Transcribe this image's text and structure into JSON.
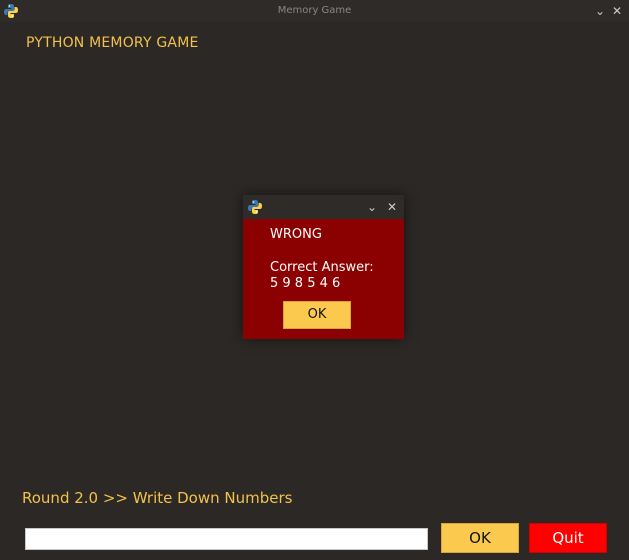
{
  "window": {
    "title": "Memory Game",
    "icon": "python-logo-icon",
    "minimize_glyph": "⌄",
    "close_glyph": "✕"
  },
  "app": {
    "heading": "PYTHON MEMORY GAME",
    "round_label": "Round 2.0 >> Write Down Numbers"
  },
  "input": {
    "value": ""
  },
  "buttons": {
    "ok_label": "OK",
    "quit_label": "Quit"
  },
  "dialog": {
    "icon": "python-logo-icon",
    "minimize_glyph": "⌄",
    "close_glyph": "✕",
    "status": "WRONG",
    "answer_label": "Correct Answer:",
    "answer_value": "5 9 8 5 4 6",
    "ok_label": "OK"
  },
  "colors": {
    "background": "#2c2826",
    "accent_text": "#f2c14e",
    "ok_button": "#fcc94f",
    "quit_button": "#ff0000",
    "dialog_body": "#8b0000"
  }
}
